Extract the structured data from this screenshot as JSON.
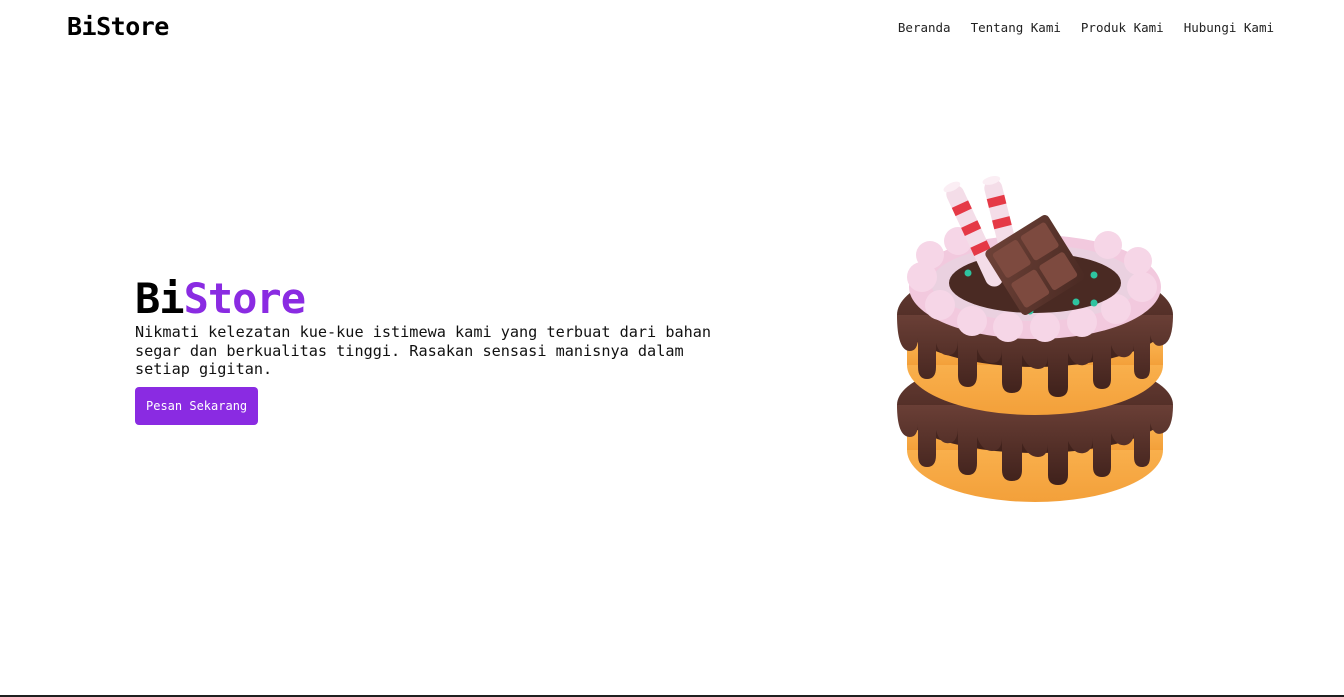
{
  "brand": "BiStore",
  "nav": {
    "items": [
      {
        "label": "Beranda"
      },
      {
        "label": "Tentang Kami"
      },
      {
        "label": "Produk Kami"
      },
      {
        "label": "Hubungi Kami"
      }
    ]
  },
  "hero": {
    "title_part1": "Bi",
    "title_part2": "Store",
    "description": "Nikmati kelezatan kue-kue istimewa kami yang terbuat dari bahan segar dan berkualitas tinggi. Rasakan sensasi manisnya dalam setiap gigitan.",
    "cta_label": "Pesan Sekarang",
    "image": "chocolate-cake-illustration"
  },
  "colors": {
    "accent": "#8a2be2",
    "text": "#000000",
    "background": "#ffffff"
  }
}
